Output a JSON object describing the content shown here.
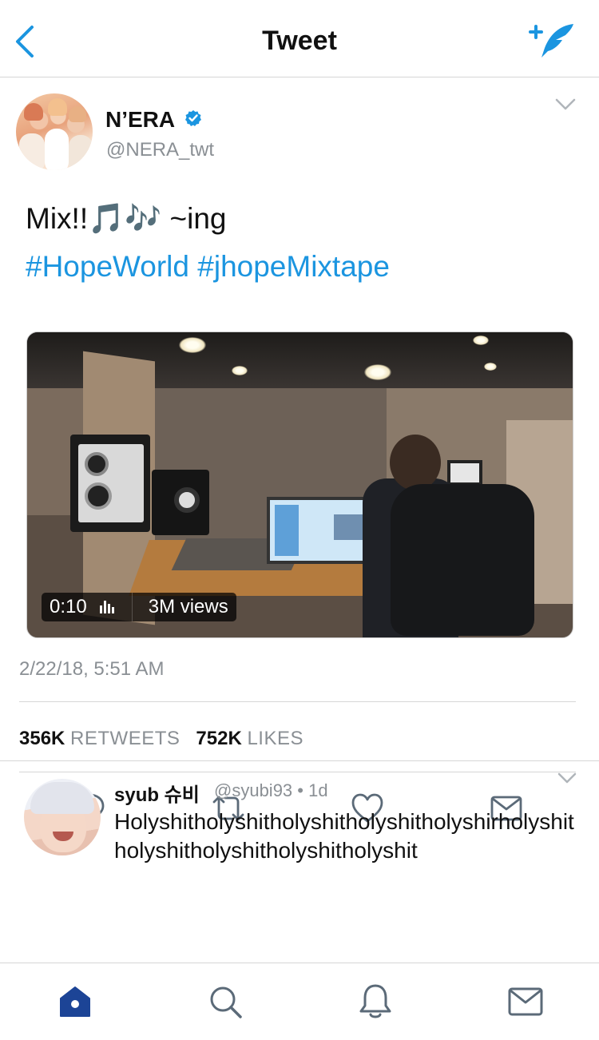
{
  "header": {
    "title": "Tweet",
    "back_icon": "chevron-left-icon",
    "compose_icon": "compose-tweet-icon"
  },
  "tweet": {
    "author": {
      "name": "N’ERA",
      "handle": "@NERA_twt",
      "verified": true
    },
    "text_line1": "Mix!!🎵🎶 ~ing",
    "hashtags": [
      "#HopeWorld",
      "#jhopeMixtape"
    ],
    "video": {
      "duration": "0:10",
      "views": "3M views"
    },
    "timestamp": "2/22/18, 5:51 AM",
    "retweets_count": "356K",
    "retweets_label": "RETWEETS",
    "likes_count": "752K",
    "likes_label": "LIKES",
    "actions": [
      "reply-icon",
      "retweet-icon",
      "like-icon",
      "direct-message-icon"
    ]
  },
  "reply": {
    "name": "syub 슈비",
    "handle": "@syubi93",
    "time": "1d",
    "text": "Holyshitholyshitholyshitholyshitholyshirholyshitholyshitholyshitholyshitholyshit"
  },
  "tabbar": [
    "home-icon",
    "search-icon",
    "notifications-icon",
    "messages-icon"
  ],
  "colors": {
    "accent": "#1b95e0",
    "tab_active": "#1c4496",
    "muted": "#8a8f94"
  }
}
